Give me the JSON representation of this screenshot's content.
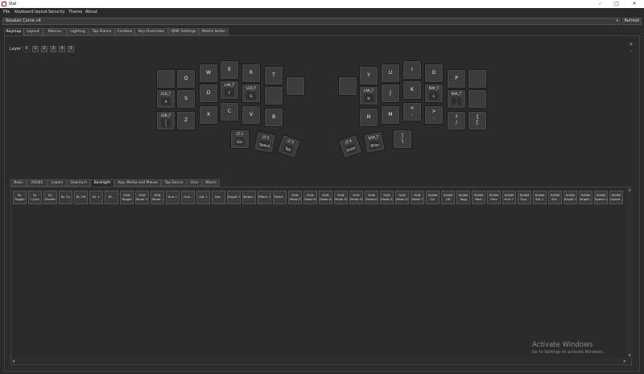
{
  "window": {
    "title": "Vial"
  },
  "menu": [
    "File",
    "Keyboard layout",
    "Security",
    "Theme",
    "About"
  ],
  "keyboard_select": {
    "value": "Rosalan Corne v4",
    "refresh_label": "Refresh"
  },
  "main_tabs": [
    "Keymap",
    "Layout",
    "Macros",
    "Lighting",
    "Tap Dance",
    "Combos",
    "Key Overrides",
    "QMK Settings",
    "Matrix tester"
  ],
  "layer": {
    "label": "Layer",
    "buttons": [
      "0",
      "1",
      "2",
      "3",
      "4",
      "5"
    ]
  },
  "zoom": {
    "in": "+",
    "out": "-"
  },
  "keys": [
    {
      "main": "",
      "sub": ""
    },
    {
      "main": "Q",
      "sub": ""
    },
    {
      "main": "W",
      "sub": ""
    },
    {
      "main": "E",
      "sub": ""
    },
    {
      "main": "R",
      "sub": ""
    },
    {
      "main": "T",
      "sub": ""
    },
    {
      "main": "",
      "sub": ""
    },
    {
      "top": "LCtl_T",
      "sub": "A"
    },
    {
      "main": "S",
      "sub": ""
    },
    {
      "main": "D",
      "sub": ""
    },
    {
      "top": "LAlt_T",
      "sub": "F"
    },
    {
      "top": "LCtl_T",
      "sub": "G"
    },
    {
      "main": "",
      "sub": ""
    },
    {
      "top": "LSft_T",
      "sub": "|\n\\"
    },
    {
      "main": "Z",
      "sub": ""
    },
    {
      "main": "X",
      "sub": ""
    },
    {
      "main": "C",
      "sub": ""
    },
    {
      "main": "V",
      "sub": ""
    },
    {
      "main": "B",
      "sub": ""
    },
    {
      "top": "LT 2",
      "sub": "Esc"
    },
    {
      "top": "LT 3",
      "sub": "Space"
    },
    {
      "top": "LT 5",
      "sub": "Tab"
    },
    {
      "main": "Y",
      "sub": ""
    },
    {
      "main": "U",
      "sub": ""
    },
    {
      "main": "I",
      "sub": ""
    },
    {
      "main": "O",
      "sub": ""
    },
    {
      "main": "P",
      "sub": ""
    },
    {
      "main": "",
      "sub": ""
    },
    {
      "main": "",
      "sub": ""
    },
    {
      "top": "LAlt_T",
      "sub": "H"
    },
    {
      "main": "J",
      "sub": ""
    },
    {
      "main": "K",
      "sub": ""
    },
    {
      "top": "RAlt_T",
      "sub": "L"
    },
    {
      "top": "RAlt_T",
      "sub": ":\n;"
    },
    {
      "main": "",
      "sub": ""
    },
    {
      "main": "N",
      "sub": ""
    },
    {
      "main": "M",
      "sub": ""
    },
    {
      "main": "<\n,",
      "sub": ""
    },
    {
      "main": ">\n.",
      "sub": ""
    },
    {
      "main": "?\n/",
      "sub": ""
    },
    {
      "main": "{\n[",
      "sub": ""
    },
    {
      "top": "LT 4",
      "sub": "Enter"
    },
    {
      "top": "SGR_T",
      "sub": "Bksp"
    },
    {
      "main": "|\n\\",
      "sub": ""
    }
  ],
  "category_tabs": [
    "Basic",
    "ISO/JIS",
    "Layers",
    "Quantum",
    "Backlight",
    "App, Media and Mouse",
    "Tap Dance",
    "User",
    "Macro"
  ],
  "keycodes": [
    "BL\nToggle",
    "BL\nCycle",
    "BL\nBreath",
    "BL On",
    "BL Off",
    "BL +",
    "BL -",
    "RGB\nToggle",
    "RGB\nMode +",
    "RGB\nMode -",
    "Hue +",
    "Hue -",
    "Sat +",
    "Sat -",
    "Bright +",
    "Bright -",
    "Effect +",
    "Effect -",
    "RGB\nMode P",
    "RGB\nMode B",
    "RGB\nMode R",
    "RGB\nMode SW",
    "RGB\nMode SN",
    "RGB\nMode K",
    "RGB\nMode X",
    "RGB\nMode G",
    "RGB\nMode T",
    "RGBM\nOn",
    "RGBM\nOff",
    "RGBM\nTogg",
    "RGBM\nNext",
    "RGBM\nPrev",
    "RGBM\nHue +",
    "RGBM\nHue -",
    "RGBM\nSat +",
    "RGBM\nSat -",
    "RGBM\nBright +",
    "RGBM\nBright -",
    "RGBM\nSpeed +",
    "RGBM\nSpeed -"
  ],
  "watermark": {
    "line1": "Activate Windows",
    "line2": "Go to Settings to activate Windows."
  }
}
